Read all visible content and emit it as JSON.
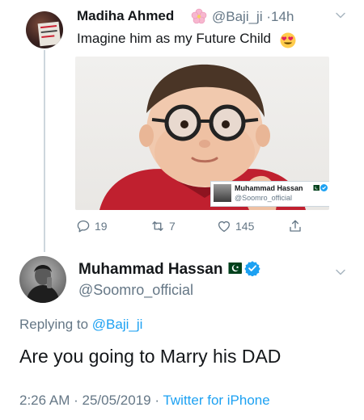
{
  "tweet1": {
    "author_name": "Madiha Ahmed",
    "author_emoji": "cherry-blossom-icon",
    "handle": "@Baji_ji",
    "separator": "·",
    "time": "14h",
    "text": "Imagine him as my Future Child",
    "text_emoji": "heart-eyes-icon",
    "image_credit": {
      "name": "Muhammad Hassan",
      "handle": "@Soomro_official"
    },
    "actions": {
      "replies": "19",
      "retweets": "7",
      "likes": "145"
    }
  },
  "tweet2": {
    "author_name": "Muhammad Hassan",
    "handle": "@Soomro_official",
    "replying_prefix": "Replying to",
    "replying_to": "@Baji_ji",
    "text": "Are you going to Marry his DAD",
    "time": "2:26 AM",
    "separator1": "·",
    "date": "25/05/2019",
    "separator2": "·",
    "source": "Twitter for iPhone"
  },
  "colors": {
    "link": "#1da1f2",
    "secondary_text": "#657786",
    "primary_text": "#14171a",
    "thread_line": "#cdd6dd"
  }
}
